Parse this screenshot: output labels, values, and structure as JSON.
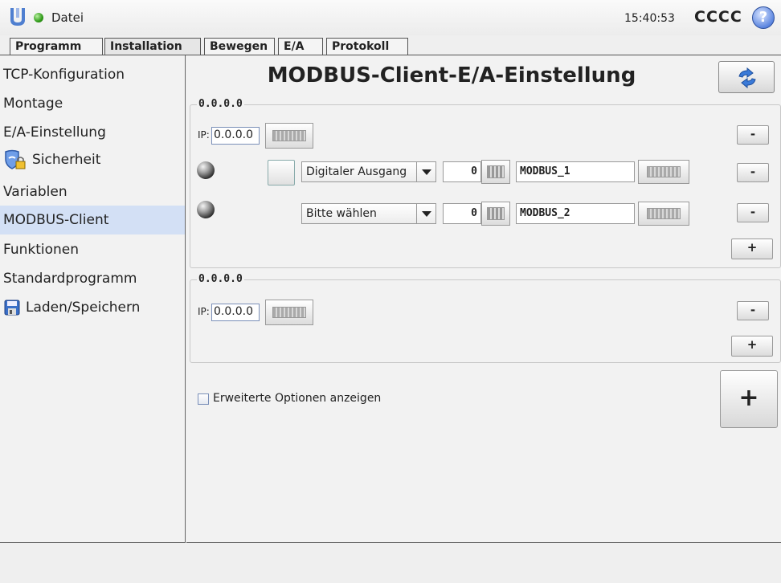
{
  "header": {
    "file_menu": "Datei",
    "clock": "15:40:53",
    "robot_name": "CCCC",
    "help_symbol": "?",
    "status_color": "#2f9a18"
  },
  "tabs": [
    {
      "label": "Programm",
      "active": false
    },
    {
      "label": "Installation",
      "active": true
    },
    {
      "label": "Bewegen",
      "active": false
    },
    {
      "label": "E/A",
      "active": false
    },
    {
      "label": "Protokoll",
      "active": false
    }
  ],
  "sidebar": {
    "items": [
      {
        "label": "TCP-Konfiguration"
      },
      {
        "label": "Montage"
      },
      {
        "label": "E/A-Einstellung"
      },
      {
        "label": "Sicherheit",
        "icon": "shield-lock-icon"
      },
      {
        "label": "Variablen"
      },
      {
        "label": "MODBUS-Client",
        "active": true
      },
      {
        "label": "Funktionen"
      },
      {
        "label": "Standardprogramm"
      },
      {
        "label": "Laden/Speichern",
        "icon": "floppy-disk-icon"
      }
    ],
    "active_color": "#d3e0f5"
  },
  "main": {
    "title": "MODBUS-Client-E/A-Einstellung",
    "refresh_icon": "refresh-arrows-icon",
    "units": [
      {
        "label": "0.0.0.0",
        "ip_prefix": "IP:",
        "ip_value": "0.0.0.0",
        "remove_label": "-",
        "signals": [
          {
            "type": "Digitaler Ausgang",
            "address": "0",
            "name": "MODBUS_1",
            "remove_label": "-"
          },
          {
            "type": "Bitte wählen",
            "address": "0",
            "name": "MODBUS_2",
            "remove_label": "-"
          }
        ],
        "add_label": "+"
      },
      {
        "label": "0.0.0.0",
        "ip_prefix": "IP:",
        "ip_value": "0.0.0.0",
        "remove_label": "-",
        "signals": [],
        "add_label": "+"
      }
    ],
    "advanced_options_label": "Erweiterte Optionen anzeigen",
    "advanced_options_checked": false,
    "add_unit_label": "+"
  }
}
